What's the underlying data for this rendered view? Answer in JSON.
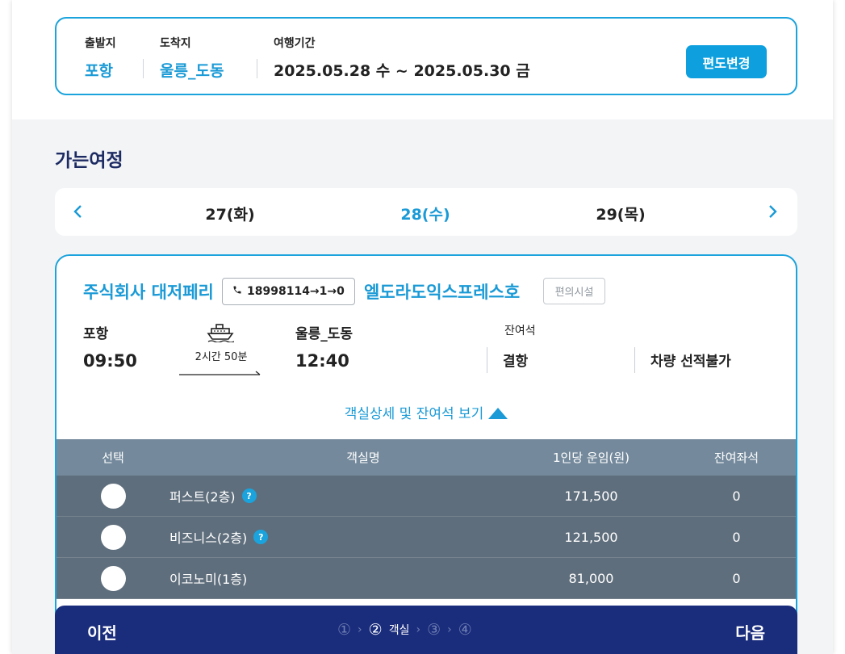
{
  "summary": {
    "departure_label": "출발지",
    "departure_value": "포항",
    "arrival_label": "도착지",
    "arrival_value": "울릉_도동",
    "period_label": "여행기간",
    "period_value": "2025.05.28 수 ~ 2025.05.30 금",
    "change_button": "편도변경"
  },
  "section_title": "가는여정",
  "datebar": {
    "dates": [
      "27(화)",
      "28(수)",
      "29(목)"
    ],
    "active_index": 1
  },
  "voyage": {
    "company": "주식회사 대저페리",
    "phone": "18998114→1→0",
    "ship": "엘도라도익스프레스호",
    "amenity_button": "편의시설",
    "from_port": "포항",
    "from_time": "09:50",
    "duration": "2시간 50분",
    "to_port": "울릉_도동",
    "to_time": "12:40",
    "seat_label": "잔여석",
    "status_passenger": "결항",
    "status_vehicle": "차량 선적불가",
    "detail_toggle": "객실상세 및 잔여석 보기"
  },
  "table": {
    "headers": {
      "select": "선택",
      "name": "객실명",
      "price": "1인당 운임(원)",
      "seats": "잔여좌석"
    },
    "rows": [
      {
        "name": "퍼스트(2층)",
        "price": "171,500",
        "seats": "0",
        "help": true
      },
      {
        "name": "비즈니스(2층)",
        "price": "121,500",
        "seats": "0",
        "help": true
      },
      {
        "name": "이코노미(1층)",
        "price": "81,000",
        "seats": "0",
        "help": false
      }
    ],
    "help_glyph": "?"
  },
  "bottom": {
    "prev": "이전",
    "next": "다음",
    "steps": [
      "①",
      "②",
      "③",
      "④"
    ],
    "current_step_label": "객실",
    "step_sep": "›"
  },
  "colors": {
    "accent": "#1a9ad6",
    "navy": "#1a2c7c",
    "table_head": "#748a9c",
    "table_row": "#5f6e7c"
  }
}
